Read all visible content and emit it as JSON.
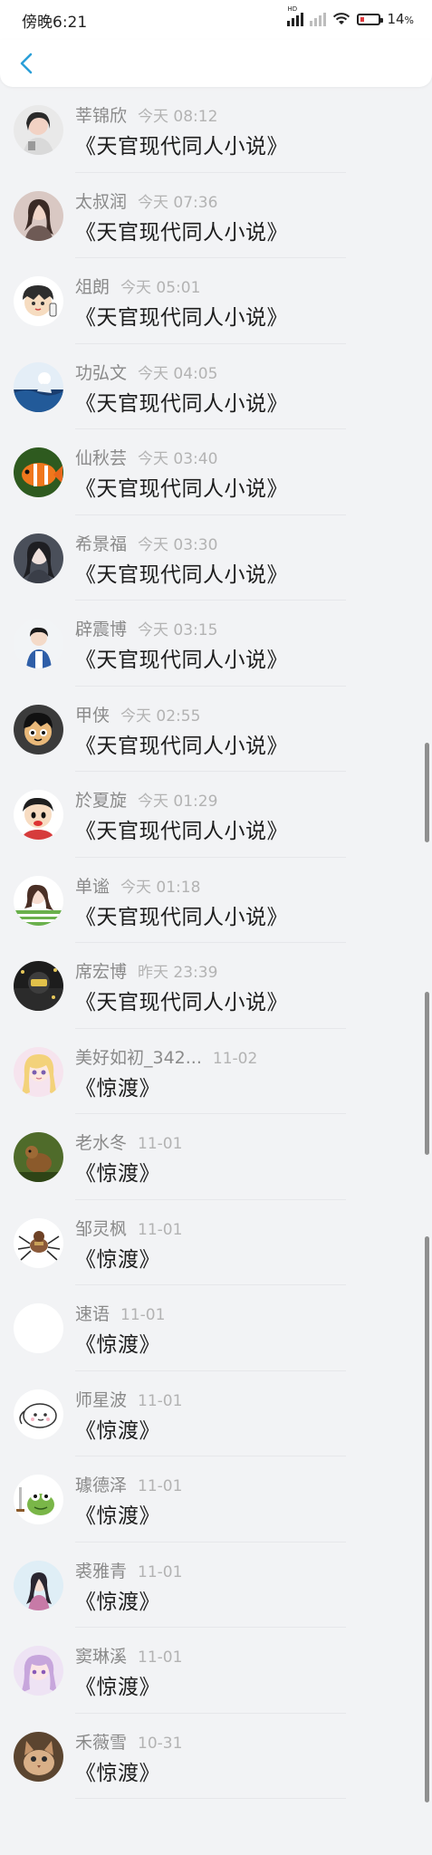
{
  "status": {
    "time": "傍晚6:21",
    "battery": "14"
  },
  "nav": {
    "back_icon": "chevron-left-icon",
    "accent": "#2b9fd8"
  },
  "messages": [
    {
      "name": "莘锦欣",
      "time": "今天 08:12",
      "title": "《天官现代同人小说》"
    },
    {
      "name": "太叔润",
      "time": "今天 07:36",
      "title": "《天官现代同人小说》"
    },
    {
      "name": "俎朗",
      "time": "今天 05:01",
      "title": "《天官现代同人小说》"
    },
    {
      "name": "功弘文",
      "time": "今天 04:05",
      "title": "《天官现代同人小说》"
    },
    {
      "name": "仙秋芸",
      "time": "今天 03:40",
      "title": "《天官现代同人小说》"
    },
    {
      "name": "希景福",
      "time": "今天 03:30",
      "title": "《天官现代同人小说》"
    },
    {
      "name": "辟震博",
      "time": "今天 03:15",
      "title": "《天官现代同人小说》"
    },
    {
      "name": "甲侠",
      "time": "今天 02:55",
      "title": "《天官现代同人小说》"
    },
    {
      "name": "於夏旋",
      "time": "今天 01:29",
      "title": "《天官现代同人小说》"
    },
    {
      "name": "单谧",
      "time": "今天 01:18",
      "title": "《天官现代同人小说》"
    },
    {
      "name": "席宏博",
      "time": "昨天 23:39",
      "title": "《天官现代同人小说》"
    },
    {
      "name": "美好如初_342...",
      "time": "11-02",
      "title": "《惊渡》"
    },
    {
      "name": "老水冬",
      "time": "11-01",
      "title": "《惊渡》"
    },
    {
      "name": "邹灵枫",
      "time": "11-01",
      "title": "《惊渡》"
    },
    {
      "name": "速语",
      "time": "11-01",
      "title": "《惊渡》"
    },
    {
      "name": "师星波",
      "time": "11-01",
      "title": "《惊渡》"
    },
    {
      "name": "璩德泽",
      "time": "11-01",
      "title": "《惊渡》"
    },
    {
      "name": "裘雅青",
      "time": "11-01",
      "title": "《惊渡》"
    },
    {
      "name": "窦琳溪",
      "time": "11-01",
      "title": "《惊渡》"
    },
    {
      "name": "禾薇雪",
      "time": "10-31",
      "title": "《惊渡》"
    }
  ]
}
